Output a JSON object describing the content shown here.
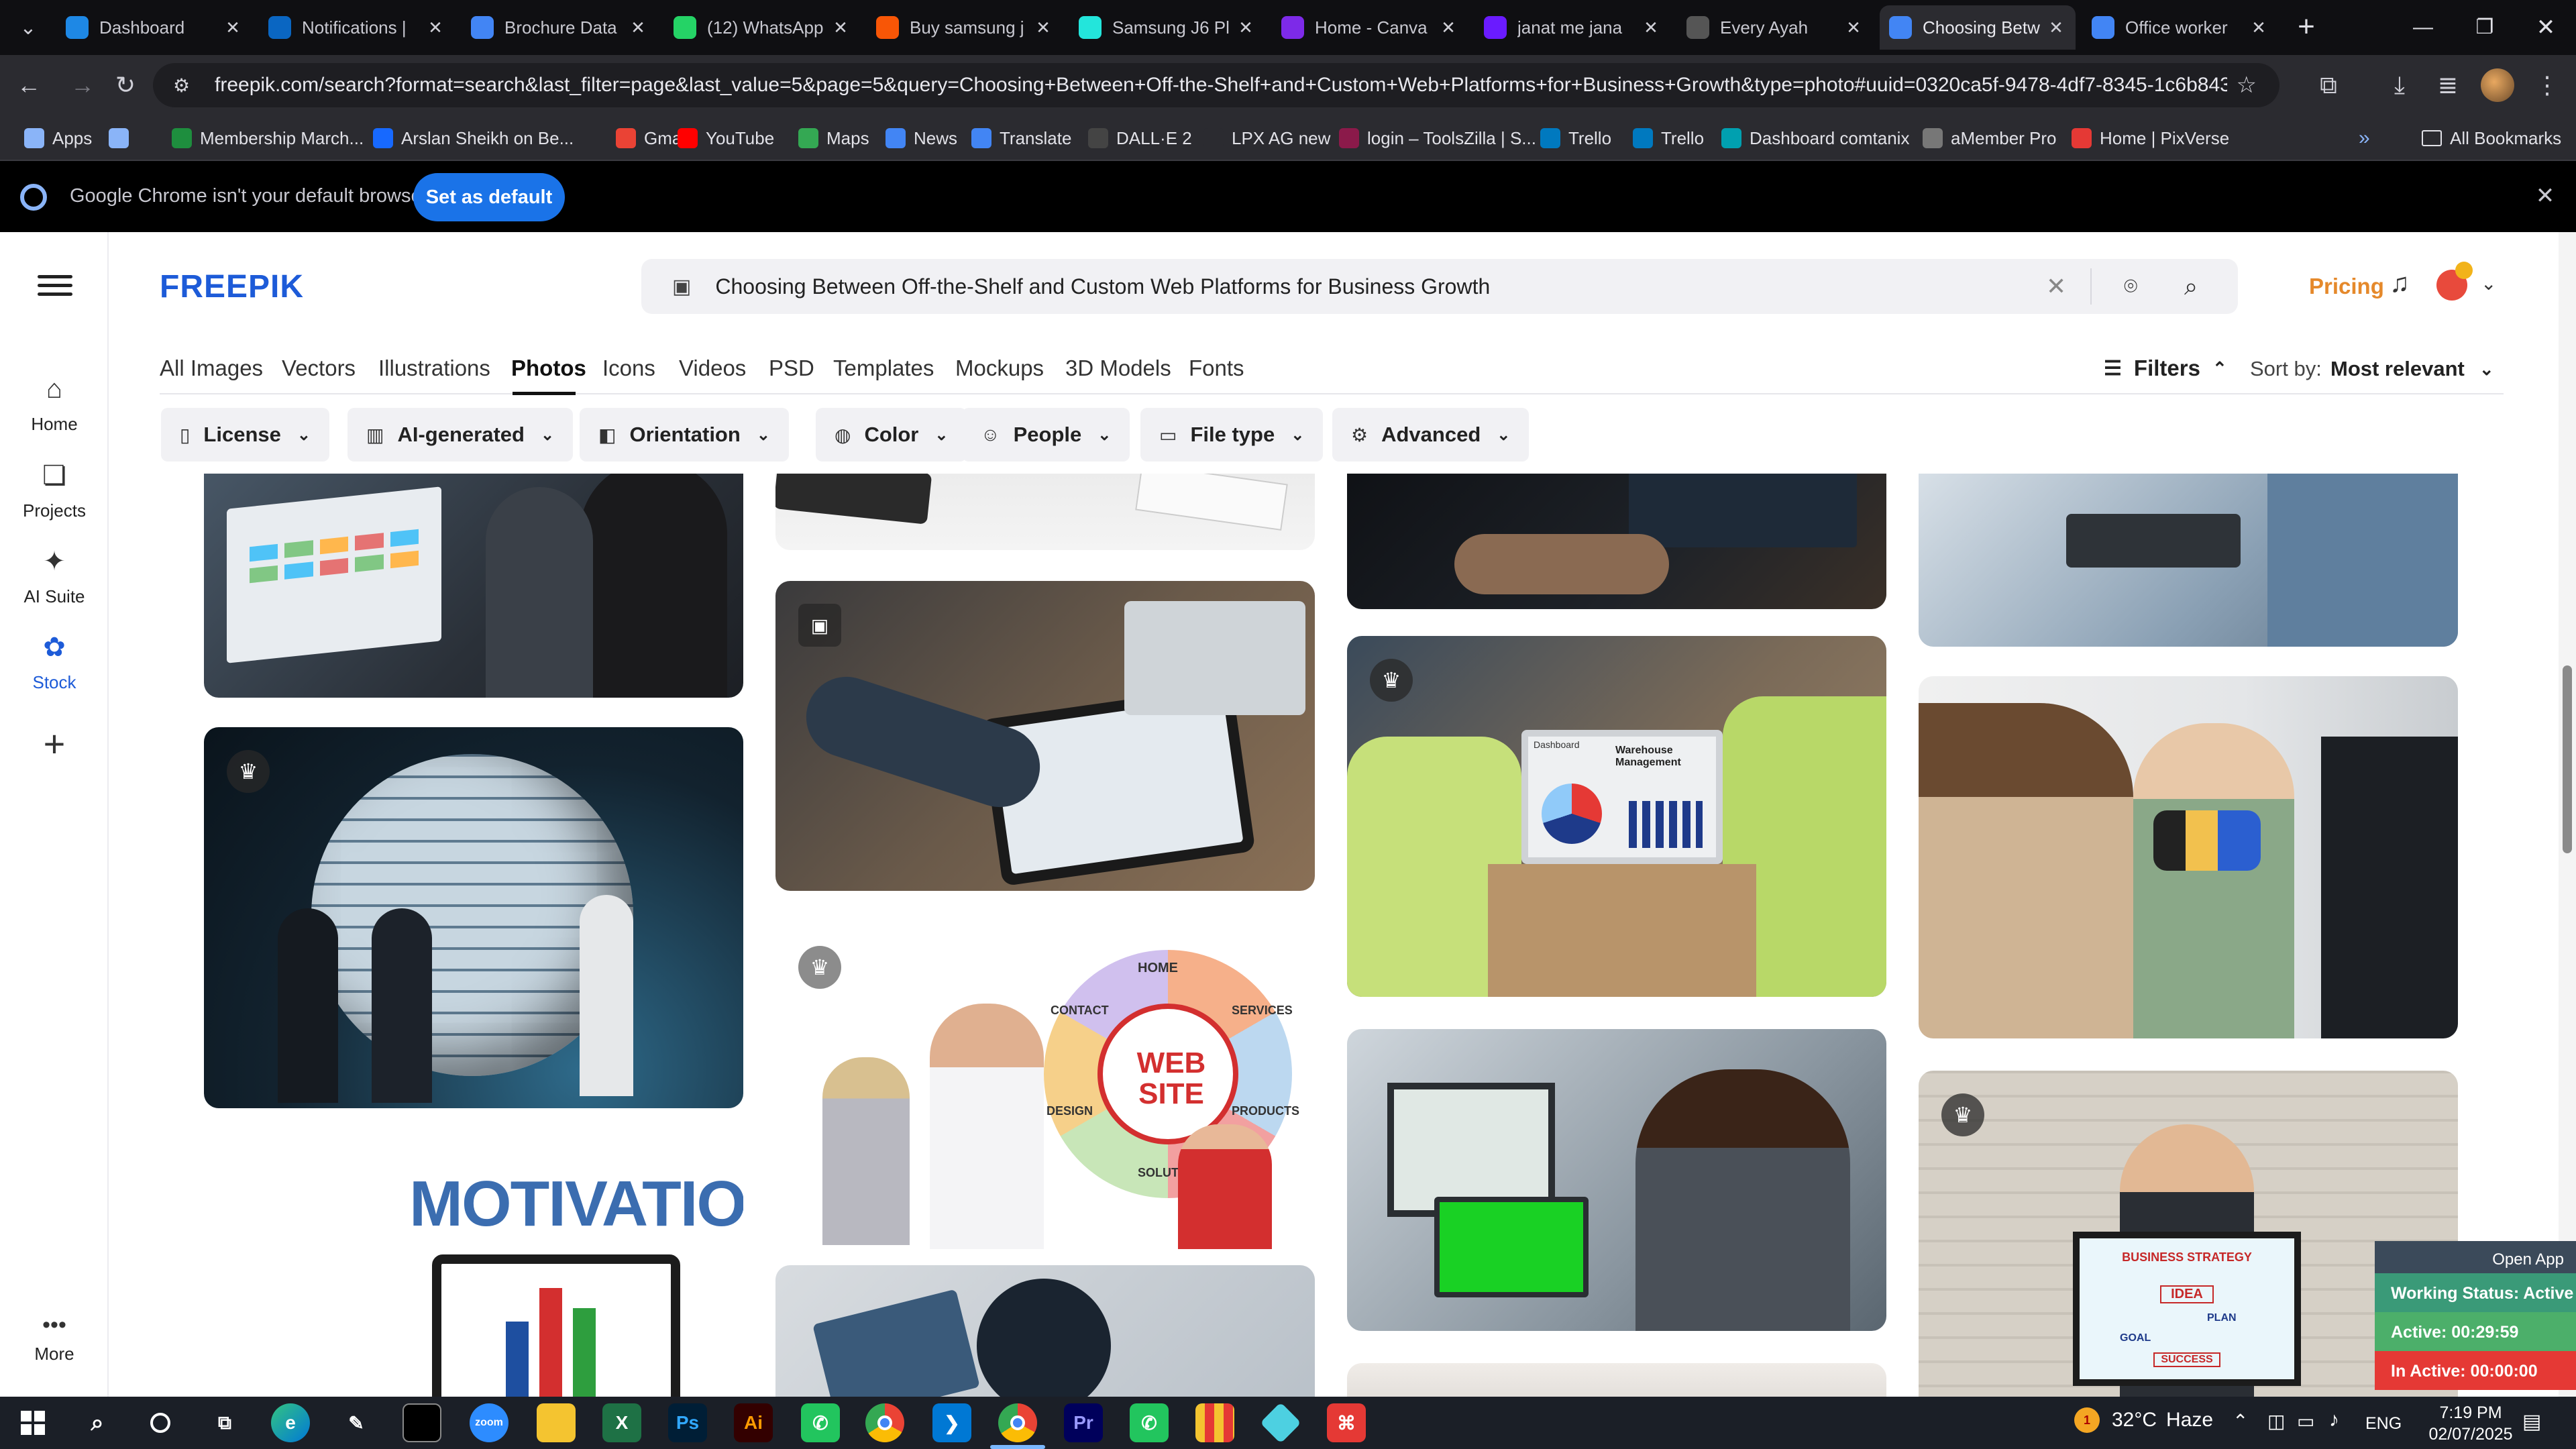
{
  "browser": {
    "tabs": [
      {
        "label": "Dashboard",
        "icon": "camtasia-icon",
        "color": "#1e88e5"
      },
      {
        "label": "Notifications |",
        "icon": "linkedin-icon",
        "color": "#0a66c2"
      },
      {
        "label": "Brochure Data",
        "icon": "google-docs-icon",
        "color": "#4285f4"
      },
      {
        "label": "(12) WhatsApp",
        "icon": "whatsapp-icon",
        "color": "#25d366"
      },
      {
        "label": "Buy samsung j",
        "icon": "daraz-icon",
        "color": "#f85606"
      },
      {
        "label": "Samsung J6 Pl",
        "icon": "olx-icon",
        "color": "#23e5db"
      },
      {
        "label": "Home - Canva",
        "icon": "canva-icon",
        "color": "#7d2ae8"
      },
      {
        "label": "janat me jana",
        "icon": "video-icon",
        "color": "#6a1bff"
      },
      {
        "label": "Every Ayah",
        "icon": "globe-icon",
        "color": "#555555"
      },
      {
        "label": "Choosing Betw",
        "icon": "google-docs-icon",
        "color": "#4285f4"
      },
      {
        "label": "Office worker",
        "icon": "google-docs-icon",
        "color": "#4285f4"
      }
    ],
    "new_tab": "+",
    "url": "freepik.com/search?format=search&last_filter=page&last_value=5&page=5&query=Choosing+Between+Off-the-Shelf+and+Custom+Web+Platforms+for+Business+Growth&type=photo#uuid=0320ca5f-9478-4df7-8345-1c6b843e55da",
    "bookmarks": [
      {
        "label": "Apps",
        "icon": "apps-grid-icon",
        "color": "#8ab4f8"
      },
      {
        "label": "",
        "icon": "grid-icon",
        "color": "#8ab4f8"
      },
      {
        "label": "Membership March...",
        "icon": "bookmark-green-icon",
        "color": "#1e8e3e"
      },
      {
        "label": "Arslan Sheikh on Be...",
        "icon": "behance-icon",
        "color": "#1769ff"
      },
      {
        "label": "Gmail",
        "icon": "gmail-icon",
        "color": "#ea4335"
      },
      {
        "label": "YouTube",
        "icon": "youtube-icon",
        "color": "#ff0000"
      },
      {
        "label": "Maps",
        "icon": "maps-icon",
        "color": "#34a853"
      },
      {
        "label": "News",
        "icon": "news-icon",
        "color": "#4285f4"
      },
      {
        "label": "Translate",
        "icon": "translate-icon",
        "color": "#4285f4"
      },
      {
        "label": "DALL·E 2",
        "icon": "openai-icon",
        "color": "#444444"
      },
      {
        "label": "LPX AG new",
        "icon": "blank-icon",
        "color": "#2b2b30"
      },
      {
        "label": "login – ToolsZilla | S...",
        "icon": "toolszilla-icon",
        "color": "#8b1a4a"
      },
      {
        "label": "Trello",
        "icon": "trello-icon",
        "color": "#0079bf"
      },
      {
        "label": "Trello",
        "icon": "trello-icon",
        "color": "#0079bf"
      },
      {
        "label": "Dashboard comtanix",
        "icon": "comtanix-icon",
        "color": "#00a0b0"
      },
      {
        "label": "aMember Pro",
        "icon": "amember-icon",
        "color": "#777777"
      },
      {
        "label": "Home | PixVerse",
        "icon": "pixverse-icon",
        "color": "#e53935"
      }
    ],
    "all_bookmarks": "All Bookmarks",
    "infobar_text": "Google Chrome isn't your default browser",
    "infobar_button": "Set as default"
  },
  "nav": {
    "logo": "FREEPIK",
    "items": [
      {
        "label": "Home",
        "icon": "home-icon"
      },
      {
        "label": "Projects",
        "icon": "projects-icon"
      },
      {
        "label": "AI Suite",
        "icon": "sparkle-icon"
      },
      {
        "label": "Stock",
        "icon": "stock-icon"
      }
    ],
    "more": "More"
  },
  "search": {
    "query": "Choosing Between Off-the-Shelf and Custom Web Platforms for Business Growth",
    "pricing": "Pricing"
  },
  "categories": [
    "All Images",
    "Vectors",
    "Illustrations",
    "Photos",
    "Icons",
    "Videos",
    "PSD",
    "Templates",
    "Mockups",
    "3D Models",
    "Fonts"
  ],
  "active_category": "Photos",
  "filters_label": "Filters",
  "sort_label": "Sort by:",
  "sort_value": "Most relevant",
  "chips": [
    "License",
    "AI-generated",
    "Orientation",
    "Color",
    "People",
    "File type",
    "Advanced"
  ],
  "card_text": {
    "motivation": "MOTIVATION",
    "website_center": "WEB SITE",
    "wheel_labels": [
      "HOME",
      "SERVICES",
      "CONTACT",
      "DESIGN",
      "PRODUCTS",
      "SOLUTIONS"
    ],
    "warehouse_title": "Warehouse Management",
    "laptop_header": "Dashboard",
    "board_title": "BUSINESS STRATEGY",
    "board_idea": "IDEA",
    "board_plan": "PLAN",
    "board_goal": "GOAL",
    "board_success": "SUCCESS"
  },
  "tracker": {
    "open_app": "Open App",
    "status": "Working Status: Active",
    "active": "Active: 00:29:59",
    "inactive": "In Active: 00:00:00"
  },
  "taskbar": {
    "weather": "32°C",
    "weather_desc": "Haze",
    "lang": "ENG",
    "time": "7:19 PM",
    "date": "02/07/2025",
    "notif_count": "1"
  }
}
